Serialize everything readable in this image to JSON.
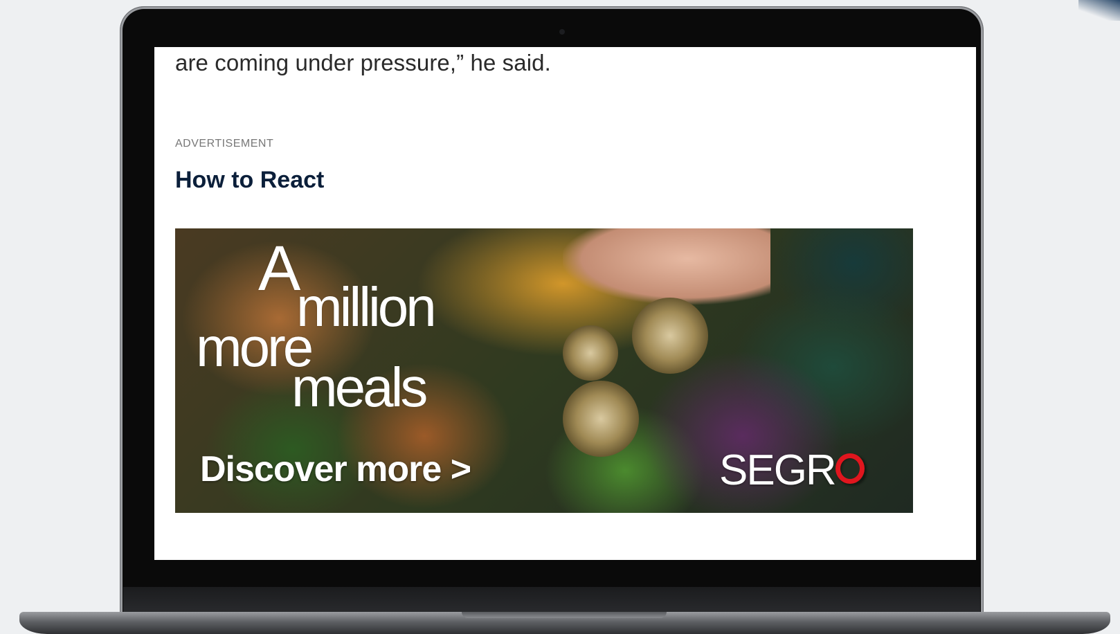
{
  "article": {
    "quote_tail": "are coming under pressure,” he said.",
    "ad_label": "ADVERTISEMENT",
    "heading": "How to React"
  },
  "banner": {
    "tagline_line1": "A",
    "tagline_line2": "million",
    "tagline_line3": "more",
    "tagline_line4": "meals",
    "cta": "Discover more >",
    "brand": "SEGR",
    "brand_last_letter": "O",
    "brand_accent": "#e0161e"
  },
  "colors": {
    "heading": "#0b1f3a",
    "body_text": "#2a2a2a",
    "ad_label": "#777777"
  }
}
